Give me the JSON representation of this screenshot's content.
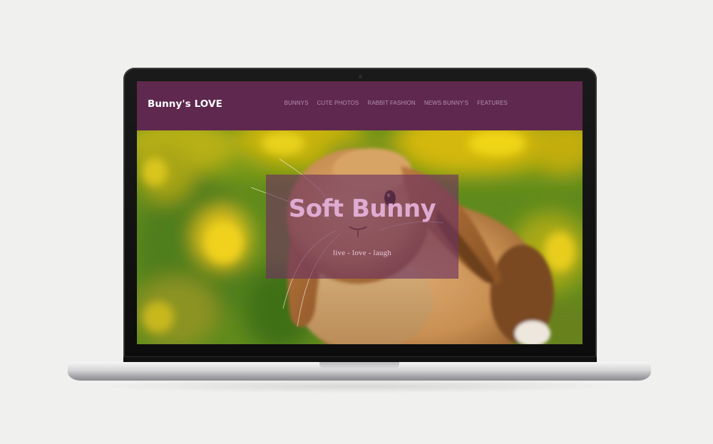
{
  "site": {
    "brand": "Bunny's LOVE",
    "nav": [
      {
        "label": "BUNNYS"
      },
      {
        "label": "CUTE PHOTOS"
      },
      {
        "label": "RABBIT FASHION"
      },
      {
        "label": "NEWS BUNNY'S"
      },
      {
        "label": "FEATURES"
      }
    ],
    "hero": {
      "title": "Soft Bunny",
      "tagline": "live - love - laugh",
      "image": "bunny-photo"
    }
  },
  "colors": {
    "navbar": "#5f284e",
    "overlay": "#6e345f",
    "background": "#f0f0ee"
  }
}
